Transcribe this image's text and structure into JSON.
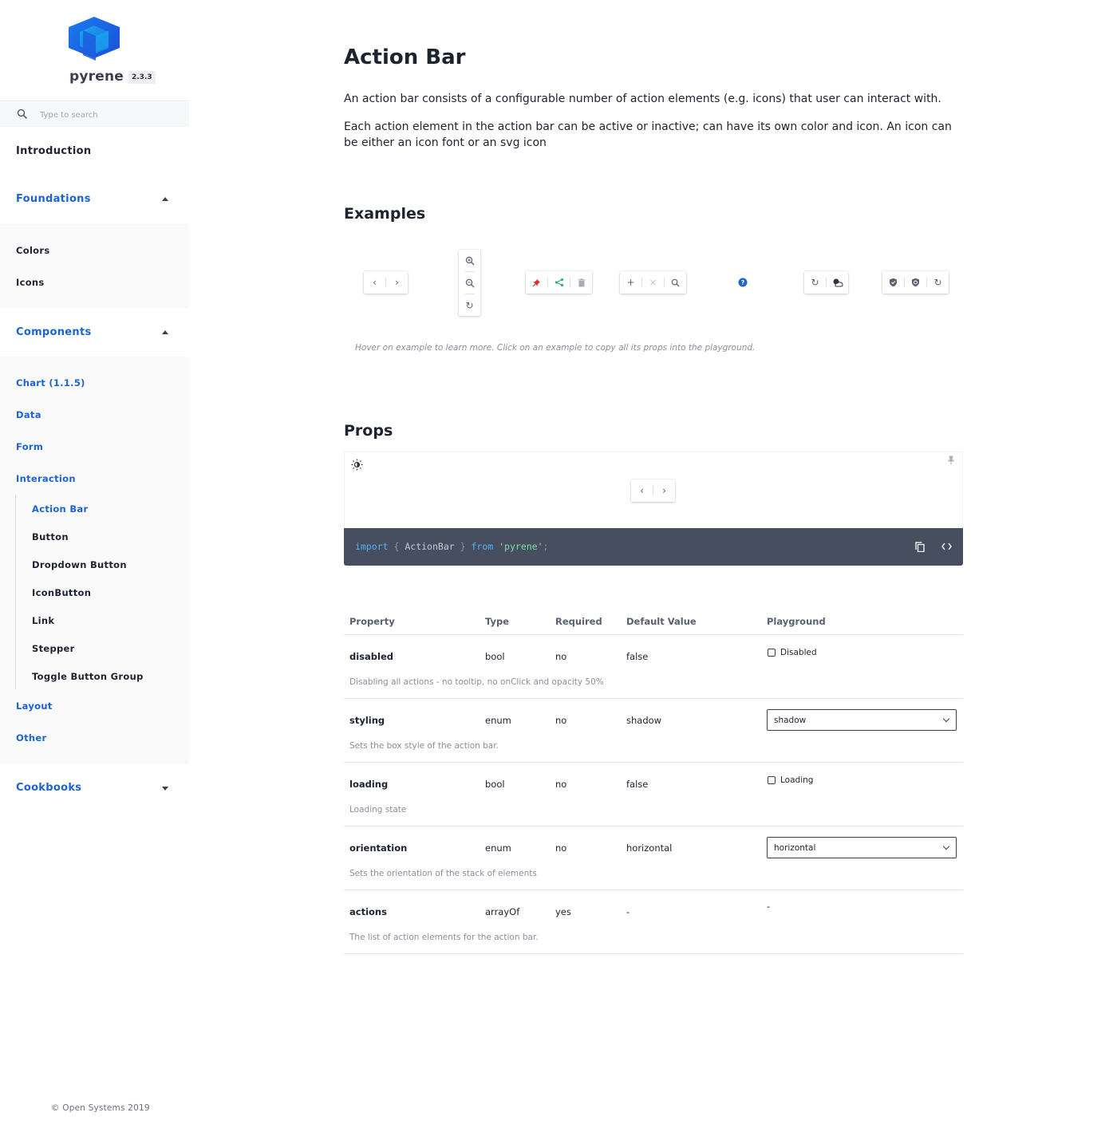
{
  "brand": {
    "name": "pyrene",
    "version": "2.3.3"
  },
  "search": {
    "placeholder": "Type to search"
  },
  "nav": {
    "introduction": "Introduction",
    "foundations": {
      "label": "Foundations",
      "items": [
        "Colors",
        "Icons"
      ]
    },
    "components": {
      "label": "Components",
      "items": [
        "Chart (1.1.5)",
        "Data",
        "Form",
        "Interaction",
        "Layout",
        "Other"
      ],
      "interaction_items": [
        "Action Bar",
        "Button",
        "Dropdown Button",
        "IconButton",
        "Link",
        "Stepper",
        "Toggle Button Group"
      ]
    },
    "cookbooks": "Cookbooks"
  },
  "footer": "© Open Systems 2019",
  "page": {
    "title": "Action Bar",
    "description_1": "An action bar consists of a configurable number of action elements (e.g. icons) that user can interact with.",
    "description_2": "Each action element in the action bar can be active or inactive; can have its own color and icon. An icon can be either an icon font or an svg icon",
    "examples_heading": "Examples",
    "examples_hint": "Hover on example to learn more. Click on an example to copy all its props into the playground.",
    "props_heading": "Props"
  },
  "code": {
    "kw_import": "import",
    "open": "{",
    "name": "ActionBar",
    "close": "}",
    "kw_from": "from",
    "module": "'pyrene'",
    "semi": ";"
  },
  "colors": {
    "accent": "#1b63d6",
    "code_bg": "#464e5f",
    "pin_red": "#e02a36",
    "share_green": "#27b56e",
    "help_blue": "#1b63d6"
  },
  "table": {
    "headers": [
      "Property",
      "Type",
      "Required",
      "Default Value",
      "Playground"
    ],
    "rows": [
      {
        "name": "disabled",
        "type": "bool",
        "required": "no",
        "default": "false",
        "description": "Disabling all actions - no tooltip, no onClick and opacity 50%",
        "control": "Disabled"
      },
      {
        "name": "styling",
        "type": "enum",
        "required": "no",
        "default": "shadow",
        "description": "Sets the box style of the action bar.",
        "control": "shadow"
      },
      {
        "name": "loading",
        "type": "bool",
        "required": "no",
        "default": "false",
        "description": "Loading state",
        "control": "Loading"
      },
      {
        "name": "orientation",
        "type": "enum",
        "required": "no",
        "default": "horizontal",
        "description": "Sets the orientation of the stack of elements",
        "control": "horizontal"
      },
      {
        "name": "actions",
        "type": "arrayOf",
        "required": "yes",
        "default": "-",
        "description": "The list of action elements for the action bar.",
        "control": "-"
      }
    ]
  }
}
